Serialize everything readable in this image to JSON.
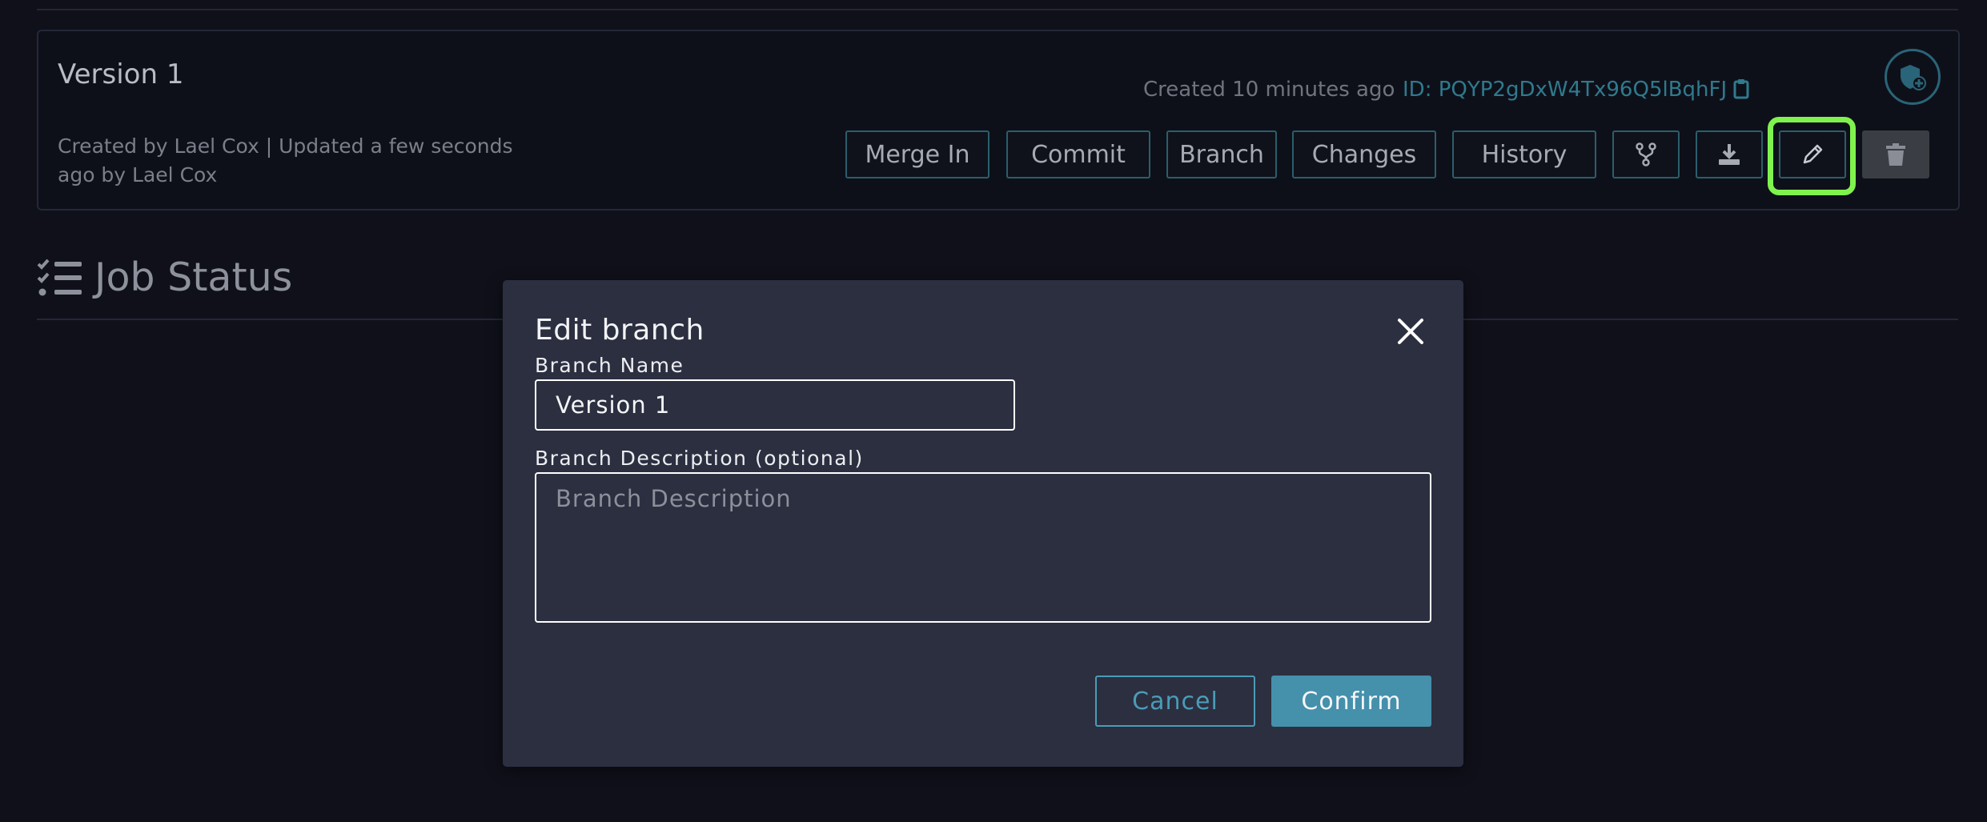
{
  "card": {
    "title": "Version 1",
    "meta": "Created by Lael Cox | Updated a few seconds ago by Lael Cox",
    "created": "Created 10 minutes ago",
    "id_text": "ID: PQYP2gDxW4Tx96Q5lBqhFJ",
    "buttons": {
      "merge_in": "Merge In",
      "commit": "Commit",
      "branch": "Branch",
      "changes": "Changes",
      "history": "History"
    },
    "icons": [
      "shield-plus-icon",
      "fork-icon",
      "download-icon",
      "pencil-icon",
      "trash-icon",
      "clipboard-icon"
    ]
  },
  "job_status": {
    "title": "Job Status",
    "icon": "tasks-list-icon"
  },
  "modal": {
    "title": "Edit branch",
    "branch_name_label": "Branch Name",
    "branch_name_value": "Version 1",
    "description_label": "Branch Description (optional)",
    "description_placeholder": "Branch Description",
    "cancel_label": "Cancel",
    "confirm_label": "Confirm"
  },
  "colors": {
    "background": "#0f1019",
    "modal": "#2c2f40",
    "accent": "#4590ab",
    "highlight": "#7ff24e"
  }
}
